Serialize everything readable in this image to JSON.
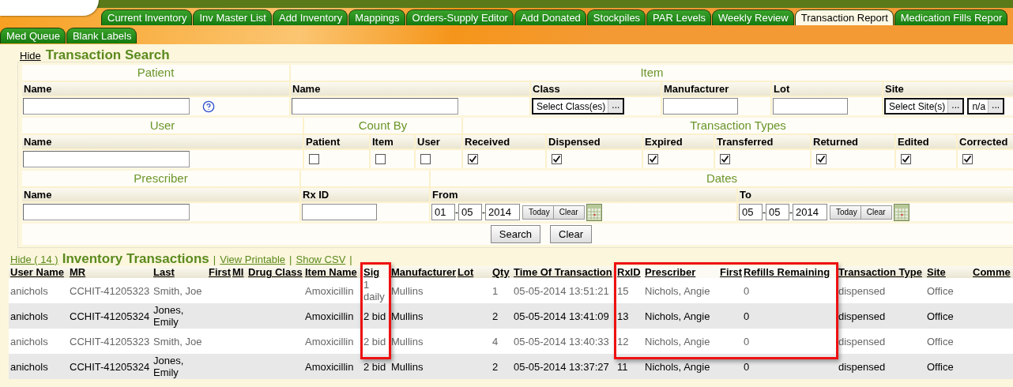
{
  "tab_rows": [
    {
      "tabs": [
        {
          "label": "Current Inventory",
          "selected": false
        },
        {
          "label": "Inv Master List",
          "selected": false
        },
        {
          "label": "Add Inventory",
          "selected": false
        },
        {
          "label": "Mappings",
          "selected": false
        },
        {
          "label": "Orders-Supply Editor",
          "selected": false
        },
        {
          "label": "Add Donated",
          "selected": false
        },
        {
          "label": "Stockpiles",
          "selected": false
        },
        {
          "label": "PAR Levels",
          "selected": false
        },
        {
          "label": "Weekly Review",
          "selected": false
        },
        {
          "label": "Transaction Report",
          "selected": true
        },
        {
          "label": "Medication Fills Repor",
          "selected": false
        }
      ]
    },
    {
      "tabs": [
        {
          "label": "Med Queue",
          "selected": false
        },
        {
          "label": "Blank Labels",
          "selected": false
        }
      ]
    }
  ],
  "search": {
    "hide_link": "Hide",
    "title": "Transaction Search",
    "sections": [
      {
        "groups": [
          {
            "title": "Patient",
            "fields": [
              {
                "label": "Name",
                "kind": "text",
                "help": true
              }
            ]
          },
          {
            "title": "Item",
            "fields": [
              {
                "label": "Name",
                "kind": "text"
              },
              {
                "label": "Class",
                "kind": "select",
                "pickers": [
                  {
                    "text": "Select Class(es)",
                    "more": "..."
                  }
                ]
              },
              {
                "label": "Manufacturer",
                "kind": "input"
              },
              {
                "label": "Lot",
                "kind": "input"
              },
              {
                "label": "Site",
                "kind": "select",
                "pickers": [
                  {
                    "text": "Select Site(s)",
                    "more": "..."
                  },
                  {
                    "text": "n/a",
                    "more": "..."
                  }
                ]
              }
            ]
          }
        ]
      },
      {
        "groups": [
          {
            "title": "User",
            "fields": [
              {
                "label": "Name",
                "kind": "text"
              }
            ]
          },
          {
            "title": "Count By",
            "fields": [
              {
                "label": "Patient",
                "kind": "checkbox",
                "checked": false
              },
              {
                "label": "Item",
                "kind": "checkbox",
                "checked": false
              },
              {
                "label": "User",
                "kind": "checkbox",
                "checked": false
              }
            ]
          },
          {
            "title": "Transaction Types",
            "fields": [
              {
                "label": "Received",
                "kind": "checkbox",
                "checked": true
              },
              {
                "label": "Dispensed",
                "kind": "checkbox",
                "checked": true
              },
              {
                "label": "Expired",
                "kind": "checkbox",
                "checked": true
              },
              {
                "label": "Transferred",
                "kind": "checkbox",
                "checked": true
              },
              {
                "label": "Returned",
                "kind": "checkbox",
                "checked": true
              },
              {
                "label": "Edited",
                "kind": "checkbox",
                "checked": true
              },
              {
                "label": "Corrected",
                "kind": "checkbox",
                "checked": true
              }
            ]
          }
        ]
      },
      {
        "groups": [
          {
            "title": "Prescriber",
            "fields": [
              {
                "label": "Name",
                "kind": "text"
              }
            ]
          },
          {
            "fields": [
              {
                "label": "Rx ID",
                "kind": "input"
              }
            ]
          },
          {
            "title": "Dates",
            "fields": [
              {
                "label": "From",
                "kind": "date",
                "parts": [
                  "01",
                  "05",
                  "2014"
                ],
                "separator": "-",
                "buttons": [
                  "Today",
                  "Clear"
                ]
              },
              {
                "label": "To",
                "kind": "date",
                "parts": [
                  "05",
                  "05",
                  "2014"
                ],
                "separator": "-",
                "buttons": [
                  "Today",
                  "Clear"
                ]
              }
            ]
          }
        ]
      }
    ],
    "buttons": [
      "Search",
      "Clear"
    ]
  },
  "results": {
    "hide_link": "Hide ( 14 )",
    "title": "Inventory Transactions",
    "separator": "|",
    "links": [
      "View Printable",
      "Show CSV"
    ],
    "columns": [
      {
        "label": "User Name",
        "framed": false
      },
      {
        "label": "MR",
        "framed": false
      },
      {
        "label": "Last",
        "framed": false
      },
      {
        "label": "First",
        "framed": false
      },
      {
        "label": "MI",
        "framed": false
      },
      {
        "label": "Drug Class",
        "framed": false
      },
      {
        "label": "Item Name",
        "framed": false
      },
      {
        "label": "Sig",
        "framed": true
      },
      {
        "label": "Manufacturer",
        "framed": false
      },
      {
        "label": "Lot",
        "framed": false
      },
      {
        "label": "Qty",
        "framed": false
      },
      {
        "label": "Time Of Transaction",
        "framed": false
      },
      {
        "label": "RxID",
        "framed": true
      },
      {
        "label": "Prescriber",
        "framed": true
      },
      {
        "label": "First",
        "framed": true
      },
      {
        "label": "Refills Remaining",
        "framed": true
      },
      {
        "label": "Transaction Type",
        "framed": false
      },
      {
        "label": "Site",
        "framed": false
      },
      {
        "label": "Comme",
        "framed": false
      }
    ],
    "rows": [
      {
        "framed": true,
        "cells": [
          "anichols",
          "CCHIT-41205323",
          "Smith, Joe",
          null,
          null,
          null,
          "Amoxicillin",
          "1 daily",
          "Mullins",
          null,
          "1",
          "05-05-2014 13:51:21",
          "15",
          "Nichols, Angie",
          null,
          "0",
          "dispensed",
          "Office",
          null
        ]
      },
      {
        "framed": true,
        "cells": [
          "anichols",
          "CCHIT-41205324",
          "Jones, Emily",
          null,
          null,
          null,
          "Amoxicillin",
          "2 bid",
          "Mullins",
          null,
          "2",
          "05-05-2014 13:41:09",
          "13",
          "Nichols, Angie",
          null,
          "0",
          "dispensed",
          "Office",
          null
        ]
      },
      {
        "framed": true,
        "cells": [
          "anichols",
          "CCHIT-41205323",
          "Smith, Joe",
          null,
          null,
          null,
          "Amoxicillin",
          "2 bid",
          "Mullins",
          null,
          "4",
          "05-05-2014 13:40:33",
          "12",
          "Nichols, Angie",
          null,
          "0",
          "dispensed",
          "Office",
          null
        ]
      },
      {
        "framed": false,
        "cells": [
          "anichols",
          "CCHIT-41205324",
          "Jones, Emily",
          null,
          null,
          null,
          "Amoxicillin",
          "2 bid",
          "Mullins",
          null,
          "2",
          "05-05-2014 13:37:27",
          "11",
          "Nichols, Angie",
          null,
          "0",
          "dispensed",
          "Office",
          null
        ]
      }
    ]
  }
}
